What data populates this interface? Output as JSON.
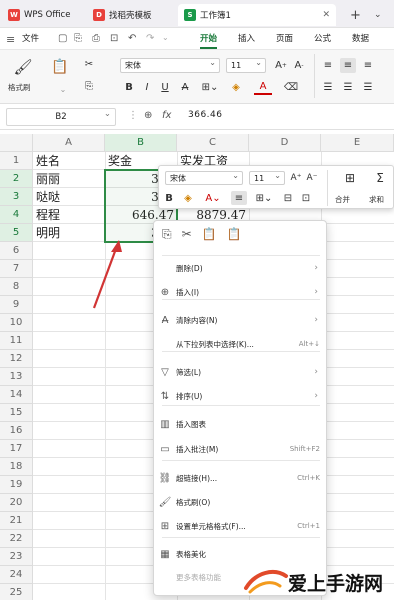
{
  "tabs": [
    {
      "label": "WPS Office",
      "icon": "wps-logo-icon",
      "color": "#e8413c",
      "active": false
    },
    {
      "label": "找稻壳模板",
      "icon": "docer-icon",
      "color": "#e8413c",
      "active": false
    },
    {
      "label": "工作簿1",
      "icon": "spreadsheet-icon",
      "color": "#1a9a4a",
      "active": true
    }
  ],
  "menu": {
    "file": "文件",
    "items": [
      "开始",
      "插入",
      "页面",
      "公式",
      "数据"
    ],
    "active": "开始"
  },
  "ribbon": {
    "format_painter": "格式刷",
    "font_name": "宋体",
    "font_size": "11"
  },
  "formula_bar": {
    "name_box": "B2",
    "fx": "fx",
    "value": "366.46"
  },
  "columns": [
    "A",
    "B",
    "C",
    "D",
    "E"
  ],
  "rows": [
    "1",
    "2",
    "3",
    "4",
    "5",
    "6",
    "7",
    "8",
    "9",
    "10",
    "11",
    "12",
    "13",
    "14",
    "15",
    "16",
    "17",
    "18",
    "19",
    "20",
    "21",
    "22",
    "23",
    "24",
    "25"
  ],
  "cells": {
    "A1": "姓名",
    "B1": "奖金",
    "C1": "实发工资",
    "A2": "丽丽",
    "B2": "366",
    "A3": "哒哒",
    "B3": "368",
    "A4": "程程",
    "B4": "646.47",
    "C4": "8879.47",
    "A5": "明明",
    "B5": "379"
  },
  "mini_toolbar": {
    "font_name": "宋体",
    "font_size": "11",
    "merge": "合并",
    "sum": "求和"
  },
  "context_menu": [
    {
      "label": "删除(D)",
      "icon": "",
      "shortcut": "",
      "arrow": true
    },
    {
      "label": "插入(I)",
      "icon": "insert-icon",
      "shortcut": "",
      "arrow": true
    },
    {
      "label": "清除内容(N)",
      "icon": "clear-icon",
      "shortcut": "",
      "arrow": true
    },
    {
      "label": "从下拉列表中选择(K)...",
      "icon": "",
      "shortcut": "Alt+↓",
      "arrow": false
    },
    {
      "label": "筛选(L)",
      "icon": "filter-icon",
      "shortcut": "",
      "arrow": true
    },
    {
      "label": "排序(U)",
      "icon": "sort-icon",
      "shortcut": "",
      "arrow": true
    },
    {
      "label": "插入图表",
      "icon": "chart-icon",
      "shortcut": "",
      "arrow": false
    },
    {
      "label": "插入批注(M)",
      "icon": "comment-icon",
      "shortcut": "Shift+F2",
      "arrow": false
    },
    {
      "label": "超链接(H)...",
      "icon": "link-icon",
      "shortcut": "Ctrl+K",
      "arrow": false
    },
    {
      "label": "格式刷(O)",
      "icon": "format-painter-icon",
      "shortcut": "",
      "arrow": false
    },
    {
      "label": "设置单元格格式(F)...",
      "icon": "format-cells-icon",
      "shortcut": "Ctrl+1",
      "arrow": false
    },
    {
      "label": "表格美化",
      "icon": "beautify-icon",
      "shortcut": "",
      "arrow": false
    },
    {
      "label": "更多表格功能",
      "icon": "",
      "shortcut": "",
      "arrow": false
    }
  ],
  "watermark": "爱上手游网",
  "colors": {
    "accent": "#1a7a3b",
    "arrow": "#d13434",
    "selection": "#2e8b46"
  }
}
